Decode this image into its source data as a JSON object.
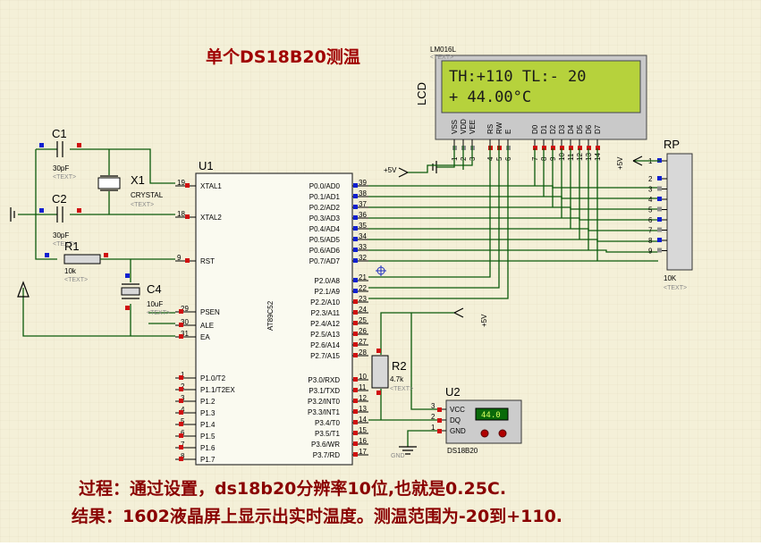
{
  "title": "单个DS18B20测温",
  "notes": {
    "line1": "过程：通过设置，ds18b20分辨率10位,也就是0.25C.",
    "line2": "结果：1602液晶屏上显示出实时温度。测温范围为-20到+110."
  },
  "lcd": {
    "model": "LM016L",
    "ref": "LCD",
    "tag": "<TEXT>",
    "line1": "TH:+110 TL:- 20",
    "line2": "+ 44.00°C",
    "pins": [
      "VSS",
      "VDD",
      "VEE",
      "RS",
      "RW",
      "E",
      "D0",
      "D1",
      "D2",
      "D3",
      "D4",
      "D5",
      "D6",
      "D7"
    ],
    "pin_numbers": [
      "1",
      "2",
      "3",
      "4",
      "5",
      "6",
      "7",
      "8",
      "9",
      "10",
      "11",
      "12",
      "13",
      "14"
    ]
  },
  "mcu": {
    "ref": "U1",
    "part": "AT89C52",
    "left_pins": [
      {
        "num": "19",
        "label": "XTAL1"
      },
      {
        "num": "18",
        "label": "XTAL2"
      },
      {
        "num": "9",
        "label": "RST"
      },
      {
        "num": "29",
        "label": "PSEN"
      },
      {
        "num": "30",
        "label": "ALE"
      },
      {
        "num": "31",
        "label": "EA"
      },
      {
        "num": "1",
        "label": "P1.0/T2"
      },
      {
        "num": "2",
        "label": "P1.1/T2EX"
      },
      {
        "num": "3",
        "label": "P1.2"
      },
      {
        "num": "4",
        "label": "P1.3"
      },
      {
        "num": "5",
        "label": "P1.4"
      },
      {
        "num": "6",
        "label": "P1.5"
      },
      {
        "num": "7",
        "label": "P1.6"
      },
      {
        "num": "8",
        "label": "P1.7"
      }
    ],
    "right_pins": [
      {
        "num": "39",
        "label": "P0.0/AD0"
      },
      {
        "num": "38",
        "label": "P0.1/AD1"
      },
      {
        "num": "37",
        "label": "P0.2/AD2"
      },
      {
        "num": "36",
        "label": "P0.3/AD3"
      },
      {
        "num": "35",
        "label": "P0.4/AD4"
      },
      {
        "num": "34",
        "label": "P0.5/AD5"
      },
      {
        "num": "33",
        "label": "P0.6/AD6"
      },
      {
        "num": "32",
        "label": "P0.7/AD7"
      },
      {
        "num": "21",
        "label": "P2.0/A8"
      },
      {
        "num": "22",
        "label": "P2.1/A9"
      },
      {
        "num": "23",
        "label": "P2.2/A10"
      },
      {
        "num": "24",
        "label": "P2.3/A11"
      },
      {
        "num": "25",
        "label": "P2.4/A12"
      },
      {
        "num": "26",
        "label": "P2.5/A13"
      },
      {
        "num": "27",
        "label": "P2.6/A14"
      },
      {
        "num": "28",
        "label": "P2.7/A15"
      },
      {
        "num": "10",
        "label": "P3.0/RXD"
      },
      {
        "num": "11",
        "label": "P3.1/TXD"
      },
      {
        "num": "12",
        "label": "P3.2/INT0"
      },
      {
        "num": "13",
        "label": "P3.3/INT1"
      },
      {
        "num": "14",
        "label": "P3.4/T0"
      },
      {
        "num": "15",
        "label": "P3.5/T1"
      },
      {
        "num": "16",
        "label": "P3.6/WR"
      },
      {
        "num": "17",
        "label": "P3.7/RD"
      }
    ]
  },
  "components": {
    "c1": {
      "ref": "C1",
      "value": "30pF",
      "tag": "<TEXT>"
    },
    "c2": {
      "ref": "C2",
      "value": "30pF",
      "tag": "<TEXT>"
    },
    "x1": {
      "ref": "X1",
      "value": "CRYSTAL",
      "tag": "<TEXT>"
    },
    "r1": {
      "ref": "R1",
      "value": "10k",
      "tag": "<TEXT>"
    },
    "c4": {
      "ref": "C4",
      "value": "10uF",
      "tag": "<TEXT>"
    },
    "r2": {
      "ref": "R2",
      "value": "4.7k",
      "tag": "<TEXT>"
    },
    "rp": {
      "ref": "RP",
      "value": "10K",
      "tag": "<TEXT>",
      "pins": [
        "1",
        "2",
        "3",
        "4",
        "5",
        "6",
        "7",
        "8",
        "9"
      ]
    },
    "u2": {
      "ref": "U2",
      "part": "DS18B20",
      "pins": [
        {
          "num": "3",
          "label": "VCC"
        },
        {
          "num": "2",
          "label": "DQ"
        },
        {
          "num": "1",
          "label": "GND"
        }
      ],
      "display": "44.0"
    }
  },
  "power": {
    "vcc_label": "+5V",
    "gnd_label": "GND"
  },
  "colors": {
    "background": "#f4f0d8",
    "wire": "#0a5a0a",
    "title": "#a00000",
    "lcd_screen": "#b6d23c",
    "pin_red": "#d01010",
    "pin_blue": "#1020d0"
  }
}
